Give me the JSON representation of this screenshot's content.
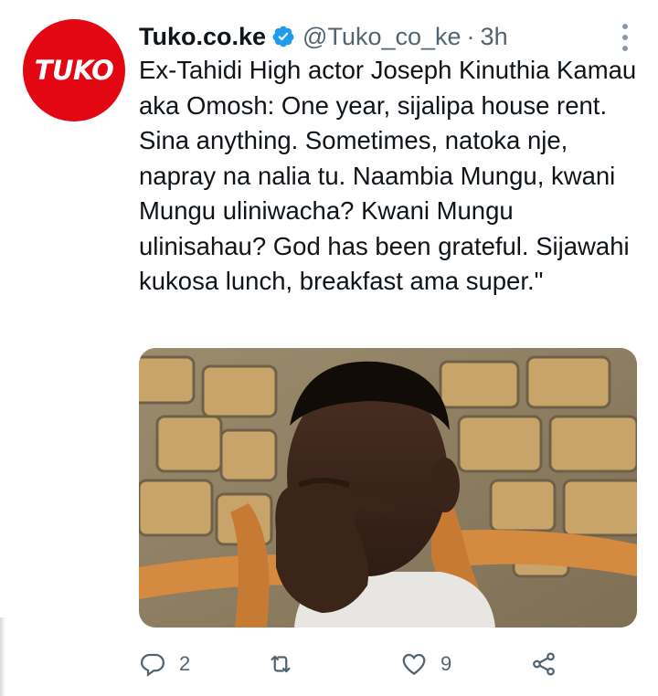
{
  "tweet": {
    "avatar_text": "TUKO",
    "display_name": "Tuko.co.ke",
    "handle": "@Tuko_co_ke",
    "separator": "·",
    "time": "3h",
    "text": "Ex-Tahidi High actor Joseph Kinuthia Kamau aka Omosh: One year, sijalipa house rent. Sina anything. Sometimes, natoka nje, napray na nalia tu. Naambia Mungu, kwani Mungu uliniwacha? Kwani Mungu ulinisahau? God has been grateful. Sijawahi kukosa lunch, breakfast ama super.\""
  },
  "actions": {
    "reply_count": "2",
    "retweet_count": "",
    "like_count": "9"
  },
  "colors": {
    "brand_red": "#e30613",
    "verified_blue": "#1d9bf0",
    "secondary_text": "#536471",
    "icon_gray": "#536471"
  },
  "icons": [
    "verified-badge-icon",
    "more-options-icon",
    "reply-icon",
    "retweet-icon",
    "like-icon",
    "share-icon"
  ]
}
